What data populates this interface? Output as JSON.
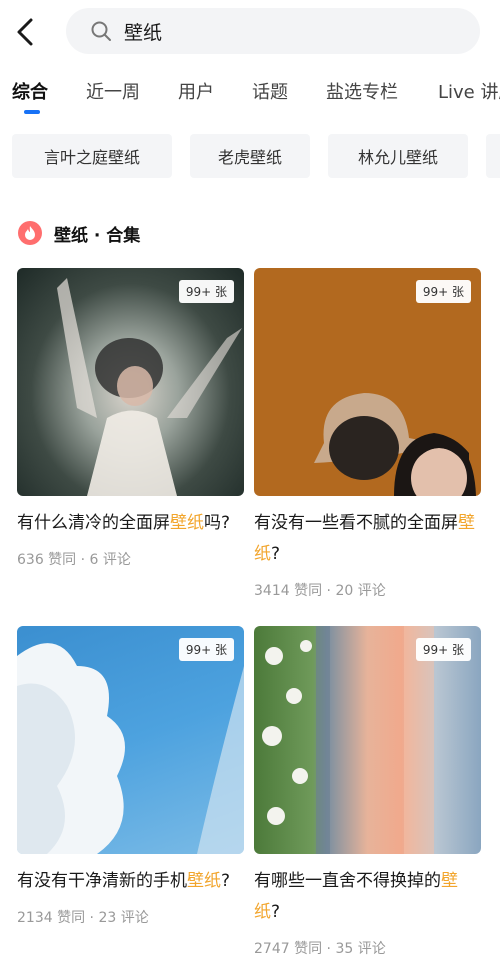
{
  "search": {
    "value": "壁纸"
  },
  "tabs": [
    {
      "label": "综合",
      "active": true
    },
    {
      "label": "近一周"
    },
    {
      "label": "用户"
    },
    {
      "label": "话题"
    },
    {
      "label": "盐选专栏"
    },
    {
      "label": "Live 讲座"
    }
  ],
  "chips": [
    "言叶之庭壁纸",
    "老虎壁纸",
    "林允儿壁纸"
  ],
  "section": {
    "title": "壁纸 · 合集"
  },
  "cards": [
    {
      "badge": "99+ 张",
      "caption_pre": "有什么清冷的全面屏",
      "caption_hl": "壁纸",
      "caption_post": "吗?",
      "likes": "636 赞同",
      "comments": "6 评论"
    },
    {
      "badge": "99+ 张",
      "caption_pre": "有没有一些看不腻的全面屏",
      "caption_hl": "壁纸",
      "caption_post": "?",
      "likes": "3414 赞同",
      "comments": "20 评论"
    },
    {
      "badge": "99+ 张",
      "caption_pre": "有没有干净清新的手机",
      "caption_hl": "壁纸",
      "caption_post": "?",
      "likes": "2134 赞同",
      "comments": "23 评论"
    },
    {
      "badge": "99+ 张",
      "caption_pre": "有哪些一直舍不得换掉的",
      "caption_hl": "壁纸",
      "caption_post": "?",
      "likes": "2747 赞同",
      "comments": "35 评论"
    }
  ],
  "meta_separator": " · ",
  "colors": {
    "accent": "#1772f6",
    "highlight": "#f2a52c",
    "muted": "#999999"
  }
}
